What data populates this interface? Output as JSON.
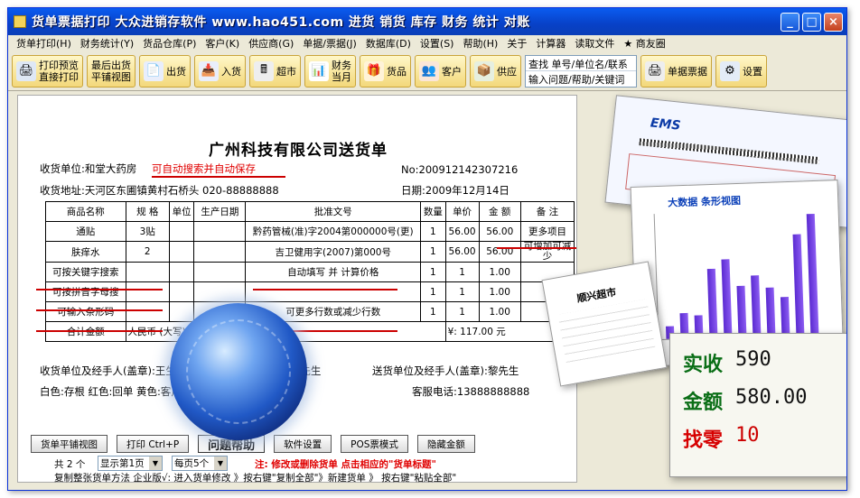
{
  "window": {
    "title": "货单票据打印  大众进销存软件  www.hao451.com  进货 销货 库存 财务 统计 对账",
    "buttons": [
      "_",
      "□",
      "×"
    ]
  },
  "menu": [
    "货单打印(H)",
    "财务统计(Y)",
    "货品仓库(P)",
    "客户(K)",
    "供应商(G)",
    "单据/票据(J)",
    "数据库(D)",
    "设置(S)",
    "帮助(H)",
    "关于",
    "计算器",
    "读取文件",
    "★ 商友圈"
  ],
  "toolbar": {
    "print_preview": "打印预览",
    "direct_print": "直接打印",
    "last_out": "最后出货",
    "flat_view": "平铺视图",
    "out": "出货",
    "in": "入货",
    "supermarket": "超市",
    "finance": "财务",
    "this_month": "当月",
    "goods": "货品",
    "customer": "客户",
    "supplier": "供应",
    "search_line1": "查找 单号/单位名/联系",
    "search_line2": "输入问题/帮助/关键词",
    "receipt": "单据票据",
    "settings": "设置"
  },
  "doc": {
    "title": "广州科技有限公司送货单",
    "recv_unit": "收货单位:和堂大药房",
    "recv_hint": "可自动搜索并自动保存",
    "no": "No:200912142307216",
    "addr": "收货地址:天河区东圃镇黄村石桥头   020-88888888",
    "date": "日期:2009年12月14日",
    "headers": [
      "商品名称",
      "规 格",
      "单位",
      "生产日期",
      "批准文号",
      "数量",
      "单价",
      "金 额",
      "备 注"
    ],
    "rows": [
      [
        "通贴",
        "3贴",
        "",
        "",
        "黔药管械(准)字2004第000000号(更)",
        "1",
        "56.00",
        "56.00",
        "更多项目"
      ],
      [
        "肤痒水",
        "2",
        "",
        "",
        "吉卫健用字(2007)第000号",
        "1",
        "56.00",
        "56.00",
        "可增加可减少"
      ],
      [
        "可按关键字搜索",
        "",
        "",
        "",
        "自动填写 并 计算价格",
        "1",
        "1",
        "1.00",
        ""
      ],
      [
        "可按拼音字母搜",
        "",
        "",
        "",
        "",
        "1",
        "1",
        "1.00",
        ""
      ],
      [
        "可输入条形码",
        "",
        "",
        "",
        "可更多行数或减少行数",
        "1",
        "1",
        "1.00",
        ""
      ]
    ],
    "total_label": "合计金额",
    "total_cn": "人民币 (大写): 壹佰壹拾柒元整",
    "total_num": "¥: 117.00 元",
    "sign_recv": "收货单位及经手人(盖章):王生",
    "sign_made": "制单:王先生",
    "sign_send": "送货单位及经手人(盖章):黎先生",
    "colors": "白色:存根      红色:回单      黄色:客户      蓝色:财务",
    "service": "客服电话:13888888888"
  },
  "bottom": {
    "btn_flat": "货单平铺视图",
    "btn_print": "打印 Ctrl+P",
    "btn_help": "问题帮助",
    "btn_settings": "软件设置",
    "btn_pos": "POS票模式",
    "btn_hide": "隐藏金额",
    "count": "共 2 个",
    "show_page": "显示第1页",
    "per_page": "每页5个",
    "note": "注: 修改或删除货单 点击相应的\"货单标题\"",
    "copy_tip": "复制整张货单方法 企业版√: 进入货单修改 》按右键\"复制全部\"》新建货单 》 按右键\"粘贴全部\""
  },
  "collage": {
    "ems": "EMS",
    "chart_title": "大数据 条形视图",
    "receipt_title": "顺兴超市",
    "pay_label": "实收",
    "pay_value": "590",
    "amount_label": "金额",
    "amount_value": "580.00",
    "change_label": "找零",
    "change_value": "10"
  }
}
